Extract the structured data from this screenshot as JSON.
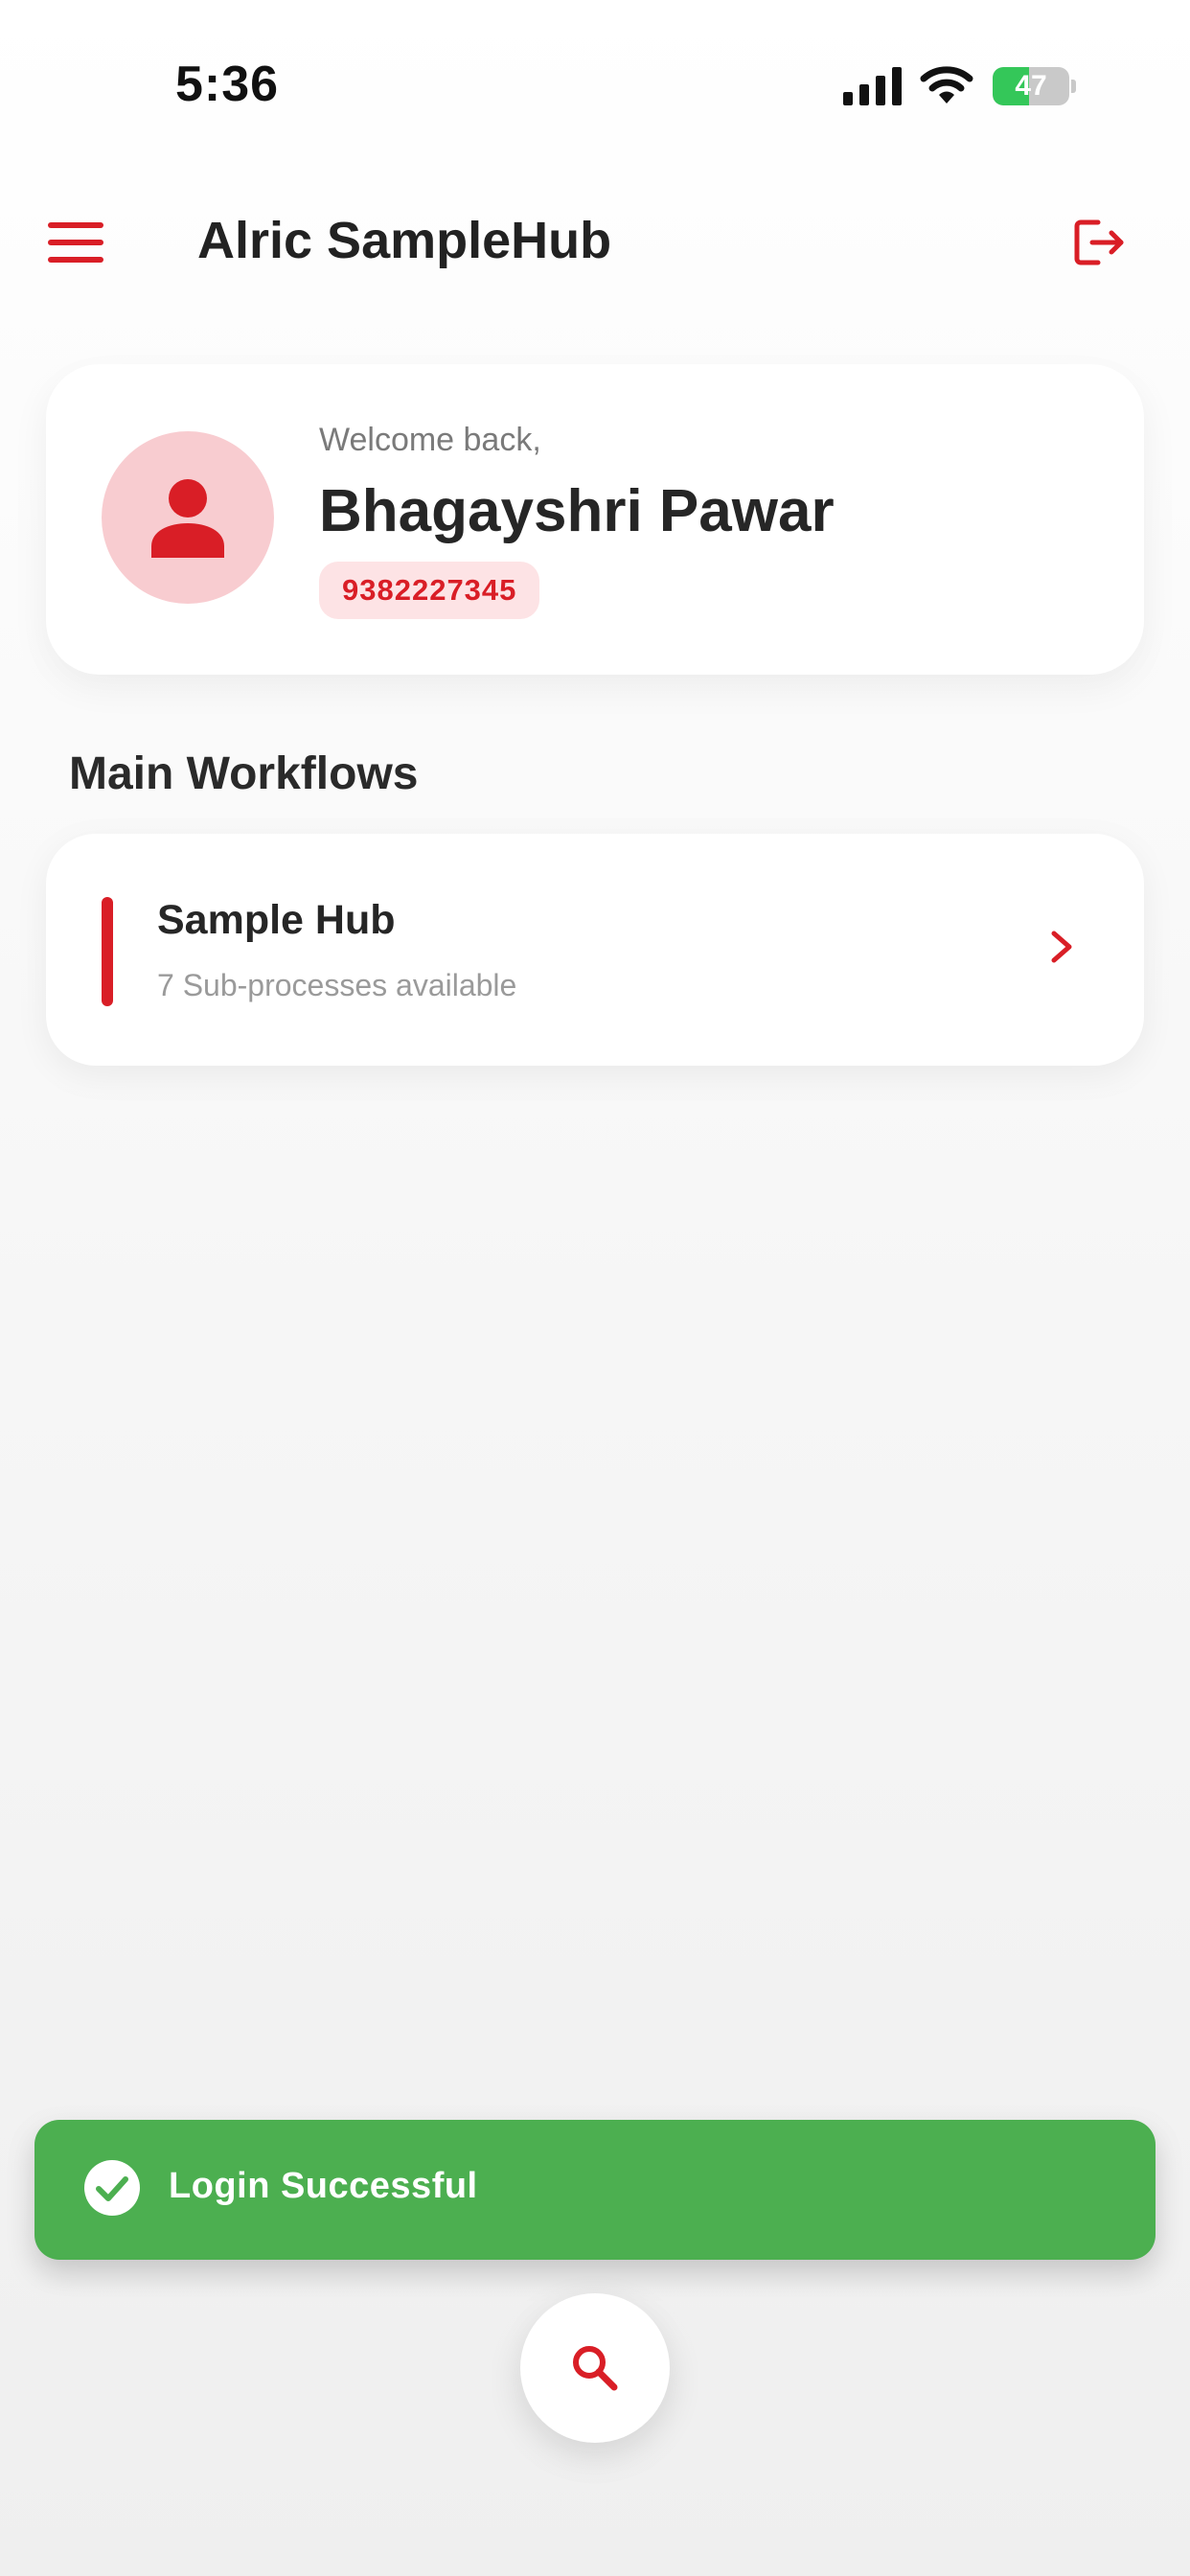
{
  "status_bar": {
    "time": "5:36",
    "battery_percent": "47",
    "battery_level": 0.47
  },
  "app_bar": {
    "title": "Alric SampleHub",
    "menu_icon": "hamburger-menu-icon",
    "logout_icon": "logout-icon"
  },
  "welcome": {
    "greeting": "Welcome back,",
    "name": "Bhagayshri Pawar",
    "phone": "9382227345",
    "avatar_icon": "person-icon"
  },
  "workflows": {
    "section_title": "Main Workflows",
    "items": [
      {
        "title": "Sample Hub",
        "subtitle": "7 Sub-processes available",
        "icon": "chevron-right-icon"
      }
    ]
  },
  "toast": {
    "message": "Login Successful",
    "icon": "check-circle-icon"
  },
  "fab": {
    "icon": "search-icon"
  },
  "colors": {
    "accent": "#d91e26",
    "avatar_bg": "#f8ccd0",
    "badge_bg": "#fde3e5",
    "toast_bg": "#4caf50",
    "battery_green": "#34c759"
  }
}
